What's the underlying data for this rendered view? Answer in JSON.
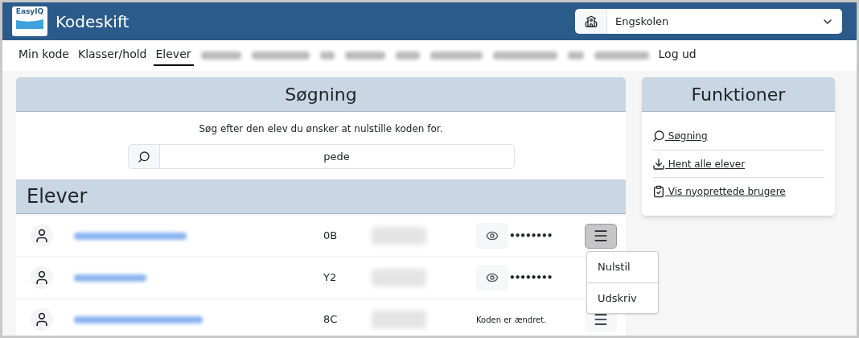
{
  "header": {
    "logo_text": "EasyIQ",
    "title": "Kodeskift",
    "school_select": {
      "value": "Engskolen"
    }
  },
  "nav": [
    {
      "label": "Min kode",
      "selected": false,
      "blurred": false
    },
    {
      "label": "Klasser/hold",
      "selected": false,
      "blurred": false
    },
    {
      "label": "Elever",
      "selected": true,
      "blurred": false
    },
    {
      "blurred": true
    },
    {
      "blurred": true
    },
    {
      "blurred": true
    },
    {
      "blurred": true
    },
    {
      "blurred": true
    },
    {
      "blurred": true
    },
    {
      "blurred": true
    },
    {
      "blurred": true
    },
    {
      "blurred": true
    },
    {
      "label": "Log ud",
      "selected": false,
      "blurred": false
    }
  ],
  "search": {
    "title": "Søgning",
    "hint": "Søg efter den elev du ønsker at nulstille koden for.",
    "value": "pede"
  },
  "students": {
    "title": "Elever",
    "rows": [
      {
        "class": "0B",
        "kind": "hidden",
        "password": "••••••••",
        "menu_open": true
      },
      {
        "class": "Y2",
        "kind": "hidden",
        "password": "••••••••",
        "menu_covered": true
      },
      {
        "class": "8C",
        "kind": "changed",
        "status": "Koden er ændret.",
        "menu_open": false
      }
    ],
    "menu": [
      "Nulstil",
      "Udskriv"
    ]
  },
  "functions": {
    "title": "Funktioner",
    "links": [
      {
        "kind": "search",
        "label": " Søgning"
      },
      {
        "kind": "download",
        "label": " Hent alle elever"
      },
      {
        "kind": "clipboard",
        "label": " Vis nyoprettede brugere"
      }
    ]
  }
}
